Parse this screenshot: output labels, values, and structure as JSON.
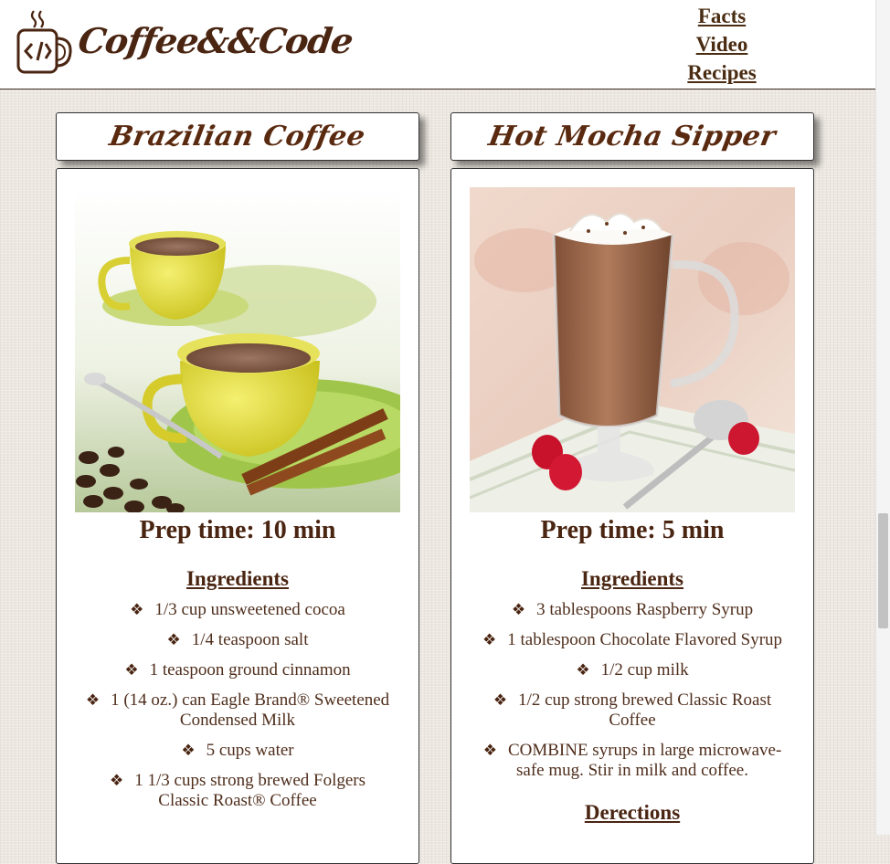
{
  "brand": {
    "name": "Coffee&&Code"
  },
  "nav": {
    "items": [
      "Facts",
      "Video",
      "Recipes"
    ]
  },
  "colors": {
    "brand": "#4a2512",
    "header_bg": "#ffffff",
    "page_bg": "#ece7e0"
  },
  "recipes": [
    {
      "title": "Brazilian Coffee",
      "prep": "Prep time: 10 min",
      "ingredients_heading": "Ingredients",
      "bullet": "❖",
      "ingredients": [
        "1/3 cup unsweetened cocoa",
        "1/4 teaspoon salt",
        "1 teaspoon ground cinnamon",
        "1 (14 oz.) can Eagle Brand® Sweetened Condensed Milk",
        "5 cups water",
        "1 1/3 cups strong brewed Folgers Classic Roast® Coffee"
      ]
    },
    {
      "title": "Hot Mocha Sipper",
      "prep": "Prep time: 5 min",
      "ingredients_heading": "Ingredients",
      "directions_heading": "Derections",
      "bullet": "❖",
      "ingredients": [
        "3 tablespoons Raspberry Syrup",
        "1 tablespoon Chocolate Flavored Syrup",
        "1/2 cup milk",
        "1/2 cup strong brewed Classic Roast Coffee",
        "COMBINE syrups in large microwave-safe mug. Stir in milk and coffee."
      ]
    }
  ]
}
